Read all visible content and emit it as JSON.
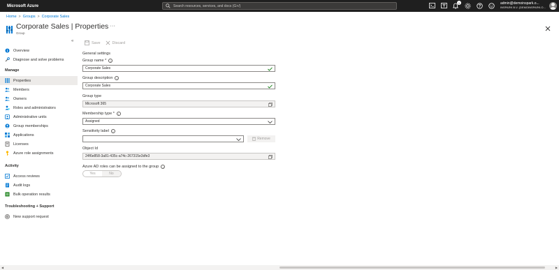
{
  "topbar": {
    "brand": "Microsoft Azure",
    "search_placeholder": "Search resources, services, and docs (G+/)",
    "notification_count": "1",
    "account_email": "admin@demoinspark.o...",
    "account_tenant": "INSPARK B.V. (DEMOINSPARK.O..."
  },
  "breadcrumb": {
    "home": "Home",
    "groups": "Groups",
    "current": "Corporate Sales",
    "separator": ">"
  },
  "header": {
    "title": "Corporate Sales | Properties",
    "subtitle": "Group",
    "more": "···"
  },
  "sidebar": {
    "collapse": "«",
    "top_items": [
      {
        "label": "Overview",
        "icon": "info-icon"
      },
      {
        "label": "Diagnose and solve problems",
        "icon": "wrench-icon"
      }
    ],
    "manage_header": "Manage",
    "manage_items": [
      {
        "label": "Properties",
        "icon": "properties-icon",
        "active": true
      },
      {
        "label": "Members",
        "icon": "members-icon"
      },
      {
        "label": "Owners",
        "icon": "owners-icon"
      },
      {
        "label": "Roles and administrators",
        "icon": "roles-icon"
      },
      {
        "label": "Administrative units",
        "icon": "admin-units-icon"
      },
      {
        "label": "Group memberships",
        "icon": "group-memberships-icon"
      },
      {
        "label": "Applications",
        "icon": "applications-icon"
      },
      {
        "label": "Licenses",
        "icon": "licenses-icon"
      },
      {
        "label": "Azure role assignments",
        "icon": "key-icon"
      }
    ],
    "activity_header": "Activity",
    "activity_items": [
      {
        "label": "Access reviews",
        "icon": "access-reviews-icon"
      },
      {
        "label": "Audit logs",
        "icon": "audit-logs-icon"
      },
      {
        "label": "Bulk operation results",
        "icon": "bulk-results-icon"
      }
    ],
    "troubleshooting_header": "Troubleshooting + Support",
    "troubleshooting_items": [
      {
        "label": "New support request",
        "icon": "support-icon"
      }
    ]
  },
  "toolbar": {
    "save": "Save",
    "discard": "Discard"
  },
  "form": {
    "section_title": "General settings",
    "group_name_label": "Group name *",
    "group_name_value": "Corporate Sales",
    "group_description_label": "Group description",
    "group_description_value": "Corporate Sales",
    "group_type_label": "Group type",
    "group_type_value": "Microsoft 365",
    "membership_type_label": "Membership type *",
    "membership_type_value": "Assigned",
    "sensitivity_label": "Sensitivity label",
    "sensitivity_value": "",
    "remove_button": "Remove",
    "object_id_label": "Object Id",
    "object_id_value": "24f6e858-3a81-435c-a74c-267315e3dfe3",
    "azure_ad_roles_label": "Azure AD roles can be assigned to the group",
    "toggle_yes": "Yes",
    "toggle_no": "No"
  }
}
